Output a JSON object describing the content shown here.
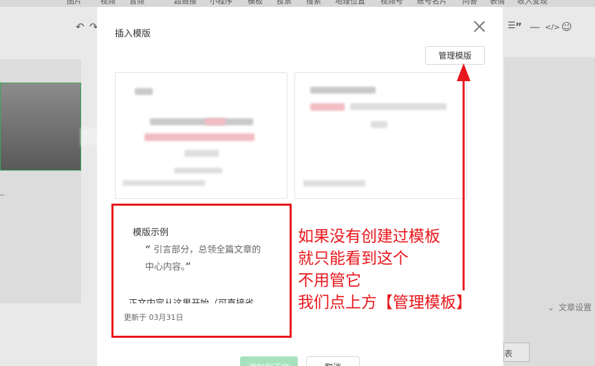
{
  "top_nav": [
    "图片",
    "视频",
    "音频",
    "超链接",
    "小程序",
    "模板",
    "投票",
    "搜索",
    "地理位置",
    "视频号",
    "账号名片",
    "问答",
    "表情",
    "收入变现"
  ],
  "toolbar_icons": [
    "undo-icon",
    "redo-icon",
    "list-icon",
    "quote-icon",
    "divider-icon",
    "code-icon",
    "emoji-icon"
  ],
  "right_panel": {
    "article_settings": "文章设置",
    "table_label": "表"
  },
  "modal": {
    "title": "插入模版",
    "manage_button": "管理模版",
    "example": {
      "title": "模版示例",
      "quote_open": "“",
      "quote_text": "引言部分，总领全篇文章的中心内容。",
      "quote_close": "”",
      "body_text": "正文内容从这里开始（可直接省",
      "updated": "更新于 03月31日"
    },
    "footer": {
      "add_button": "添加到正文",
      "cancel_button": "取消"
    }
  },
  "annotation": {
    "color": "#e8171c",
    "lines": [
      "如果没有创建过模板",
      "就只能看到这个",
      "不用管它",
      "我们点上方【管理模板】"
    ]
  }
}
